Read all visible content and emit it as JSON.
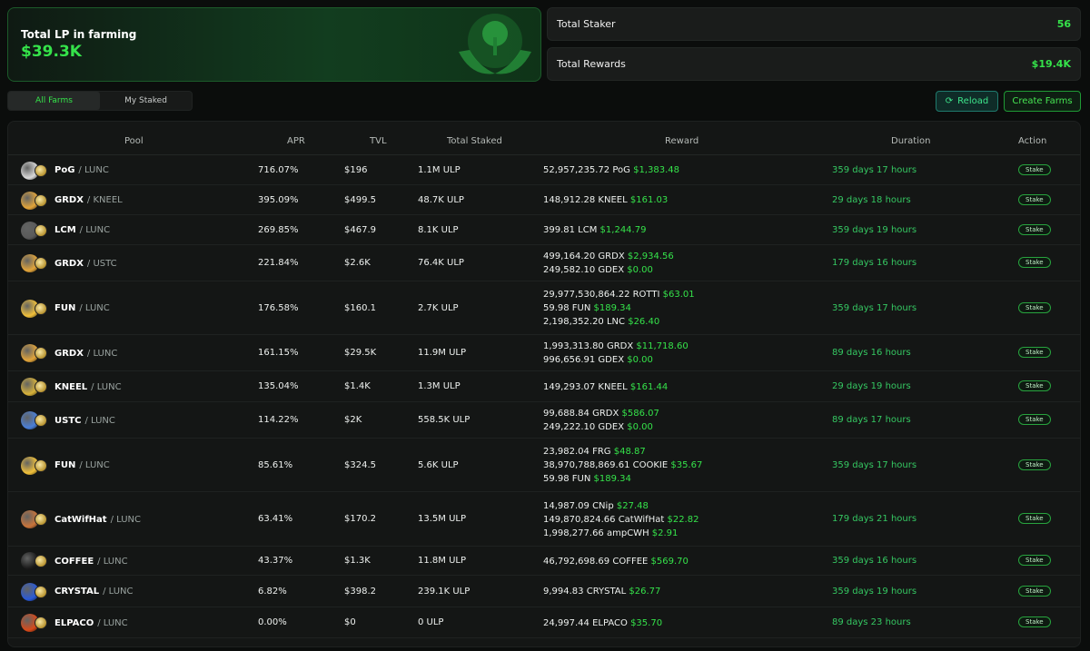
{
  "banner": {
    "label": "Total LP in farming",
    "value": "$39.3K"
  },
  "stats": [
    {
      "label": "Total Staker",
      "value": "56"
    },
    {
      "label": "Total Rewards",
      "value": "$19.4K"
    }
  ],
  "tabs": [
    {
      "label": "All Farms",
      "active": true
    },
    {
      "label": "My Staked",
      "active": false
    }
  ],
  "buttons": {
    "reload": "Reload",
    "create": "Create Farms"
  },
  "table": {
    "headers": [
      "Pool",
      "APR",
      "TVL",
      "Total Staked",
      "Reward",
      "Duration",
      "Action"
    ],
    "rows": [
      {
        "token": "PoG",
        "pair": "/ LUNC",
        "apr": "716.07%",
        "tvl": "$196",
        "staked": "1.1M ULP",
        "rewards": [
          {
            "amt": "52,957,235.72 PoG",
            "usd": "$1,383.48"
          }
        ],
        "duration": "359 days 17 hours",
        "action": "Stake",
        "color": "#d9d9d9"
      },
      {
        "token": "GRDX",
        "pair": "/ KNEEL",
        "apr": "395.09%",
        "tvl": "$499.5",
        "staked": "48.7K ULP",
        "rewards": [
          {
            "amt": "148,912.28 KNEEL",
            "usd": "$161.03"
          }
        ],
        "duration": "29 days 18 hours",
        "action": "Stake",
        "color": "#e3a53a"
      },
      {
        "token": "LCM",
        "pair": "/ LUNC",
        "apr": "269.85%",
        "tvl": "$467.9",
        "staked": "8.1K ULP",
        "rewards": [
          {
            "amt": "399.81 LCM",
            "usd": "$1,244.79"
          }
        ],
        "duration": "359 days 19 hours",
        "action": "Stake",
        "color": "#5a5a5a"
      },
      {
        "token": "GRDX",
        "pair": "/ USTC",
        "apr": "221.84%",
        "tvl": "$2.6K",
        "staked": "76.4K ULP",
        "rewards": [
          {
            "amt": "499,164.20 GRDX",
            "usd": "$2,934.56"
          },
          {
            "amt": "249,582.10 GDEX",
            "usd": "$0.00"
          }
        ],
        "duration": "179 days 16 hours",
        "action": "Stake",
        "color": "#e3a53a"
      },
      {
        "token": "FUN",
        "pair": "/ LUNC",
        "apr": "176.58%",
        "tvl": "$160.1",
        "staked": "2.7K ULP",
        "rewards": [
          {
            "amt": "29,977,530,864.22 ROTTI",
            "usd": "$63.01"
          },
          {
            "amt": "59.98 FUN",
            "usd": "$189.34"
          },
          {
            "amt": "2,198,352.20 LNC",
            "usd": "$26.40"
          }
        ],
        "duration": "359 days 17 hours",
        "action": "Stake",
        "color": "#f2c13a"
      },
      {
        "token": "GRDX",
        "pair": "/ LUNC",
        "apr": "161.15%",
        "tvl": "$29.5K",
        "staked": "11.9M ULP",
        "rewards": [
          {
            "amt": "1,993,313.80 GRDX",
            "usd": "$11,718.60"
          },
          {
            "amt": "996,656.91 GDEX",
            "usd": "$0.00"
          }
        ],
        "duration": "89 days 16 hours",
        "action": "Stake",
        "color": "#e3a53a"
      },
      {
        "token": "KNEEL",
        "pair": "/ LUNC",
        "apr": "135.04%",
        "tvl": "$1.4K",
        "staked": "1.3M ULP",
        "rewards": [
          {
            "amt": "149,293.07 KNEEL",
            "usd": "$161.44"
          }
        ],
        "duration": "29 days 19 hours",
        "action": "Stake",
        "color": "#d8b23a"
      },
      {
        "token": "USTC",
        "pair": "/ LUNC",
        "apr": "114.22%",
        "tvl": "$2K",
        "staked": "558.5K ULP",
        "rewards": [
          {
            "amt": "99,688.84 GRDX",
            "usd": "$586.07"
          },
          {
            "amt": "249,222.10 GDEX",
            "usd": "$0.00"
          }
        ],
        "duration": "89 days 17 hours",
        "action": "Stake",
        "color": "#4a7fd8"
      },
      {
        "token": "FUN",
        "pair": "/ LUNC",
        "apr": "85.61%",
        "tvl": "$324.5",
        "staked": "5.6K ULP",
        "rewards": [
          {
            "amt": "23,982.04 FRG",
            "usd": "$48.87"
          },
          {
            "amt": "38,970,788,869.61 COOKIE",
            "usd": "$35.67"
          },
          {
            "amt": "59.98 FUN",
            "usd": "$189.34"
          }
        ],
        "duration": "359 days 17 hours",
        "action": "Stake",
        "color": "#f2c13a"
      },
      {
        "token": "CatWifHat",
        "pair": "/ LUNC",
        "apr": "63.41%",
        "tvl": "$170.2",
        "staked": "13.5M ULP",
        "rewards": [
          {
            "amt": "14,987.09 CNip",
            "usd": "$27.48"
          },
          {
            "amt": "149,870,824.66 CatWifHat",
            "usd": "$22.82"
          },
          {
            "amt": "1,998,277.66 ampCWH",
            "usd": "$2.91"
          }
        ],
        "duration": "179 days 21 hours",
        "action": "Stake",
        "color": "#c9743a"
      },
      {
        "token": "COFFEE",
        "pair": "/ LUNC",
        "apr": "43.37%",
        "tvl": "$1.3K",
        "staked": "11.8M ULP",
        "rewards": [
          {
            "amt": "46,792,698.69 COFFEE",
            "usd": "$569.70"
          }
        ],
        "duration": "359 days 16 hours",
        "action": "Stake",
        "color": "#1a1a1a"
      },
      {
        "token": "CRYSTAL",
        "pair": "/ LUNC",
        "apr": "6.82%",
        "tvl": "$398.2",
        "staked": "239.1K ULP",
        "rewards": [
          {
            "amt": "9,994.83 CRYSTAL",
            "usd": "$26.77"
          }
        ],
        "duration": "359 days 19 hours",
        "action": "Stake",
        "color": "#2a5ad8"
      },
      {
        "token": "ELPACO",
        "pair": "/ LUNC",
        "apr": "0.00%",
        "tvl": "$0",
        "staked": "0 ULP",
        "rewards": [
          {
            "amt": "24,997.44 ELPACO",
            "usd": "$35.70"
          }
        ],
        "duration": "89 days 23 hours",
        "action": "Stake",
        "color": "#d84a1a"
      }
    ]
  }
}
